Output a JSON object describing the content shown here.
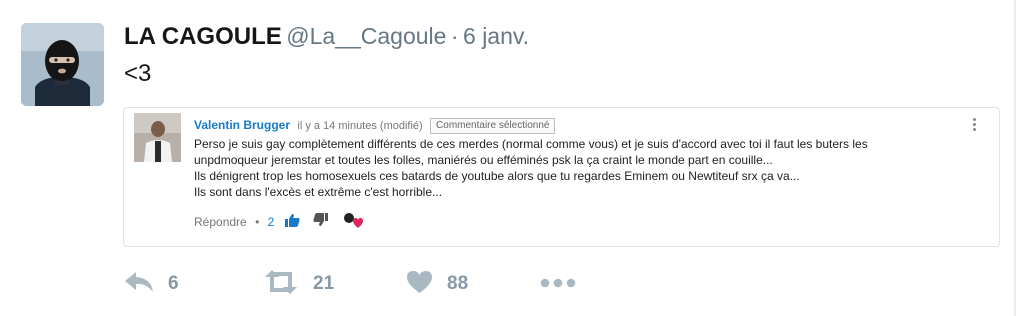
{
  "tweet": {
    "display_name": "LA CAGOULE",
    "handle": "@La__Cagoule",
    "separator": "·",
    "date": "6 janv.",
    "text": "<3"
  },
  "comment": {
    "author": "Valentin Brugger",
    "time": "il y a 14 minutes (modifié)",
    "badge": "Commentaire sélectionné",
    "lines": [
      "Perso je suis gay complètement différents de ces merdes (normal comme vous) et je suis d'accord avec toi il faut les buters les",
      "unpdmoqueur jeremstar et toutes les folles, maniérés ou efféminés psk la ça craint le monde part en couille...",
      "Ils dénigrent trop les homosexuels ces batards de youtube alors que tu regardes Eminem ou Newtiteuf srx ça va...",
      "Ils sont dans l'excès et extrême c'est horrible..."
    ],
    "reply_label": "Répondre",
    "dot": "•",
    "like_count": "2",
    "icons": [
      "thumbs-up-icon",
      "thumbs-down-icon",
      "creator-heart-icon",
      "more-vertical-icon"
    ]
  },
  "actions": {
    "reply_count": "6",
    "retweet_count": "21",
    "like_count": "88",
    "icons": [
      "reply-icon",
      "retweet-icon",
      "heart-icon",
      "more-icon"
    ]
  },
  "colors": {
    "icon_gray": "#aab8c2",
    "count_gray": "#8899a6",
    "link_blue": "#167ac6",
    "heart_red": "#e0245e"
  }
}
